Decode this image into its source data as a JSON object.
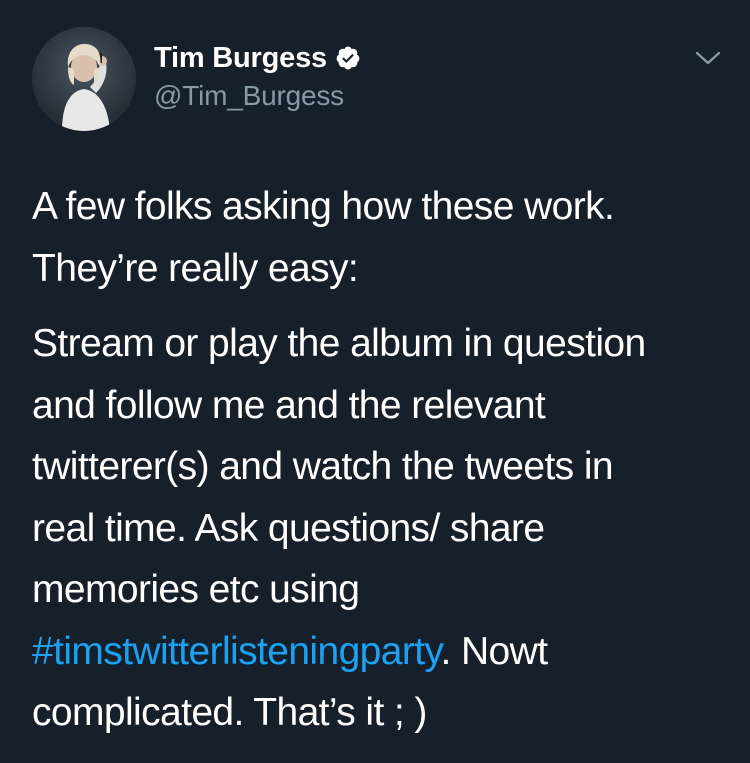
{
  "author": {
    "display_name": "Tim Burgess",
    "handle": "@Tim_Burgess",
    "verified": true
  },
  "tweet": {
    "paragraph_1_line_1": "A few folks asking how these work.",
    "paragraph_1_line_2": "They’re really easy:",
    "paragraph_2_line_1": "Stream or play the album in question",
    "paragraph_2_line_2": "and follow me and the relevant",
    "paragraph_2_line_3": "twitterer(s) and watch the tweets in",
    "paragraph_2_line_4": "real time. Ask questions/ share",
    "paragraph_2_line_5": "memories etc using",
    "hashtag": "#timstwitterlisteningparty",
    "paragraph_2_line_6_rest": ". Nowt",
    "paragraph_2_line_7": "complicated. That’s it ; )"
  },
  "icons": {
    "verified": "verified-badge-icon",
    "menu": "chevron-down-icon"
  },
  "colors": {
    "background": "#15202b",
    "text_primary": "#ffffff",
    "text_secondary": "#8899a6",
    "link": "#1da1f2"
  }
}
